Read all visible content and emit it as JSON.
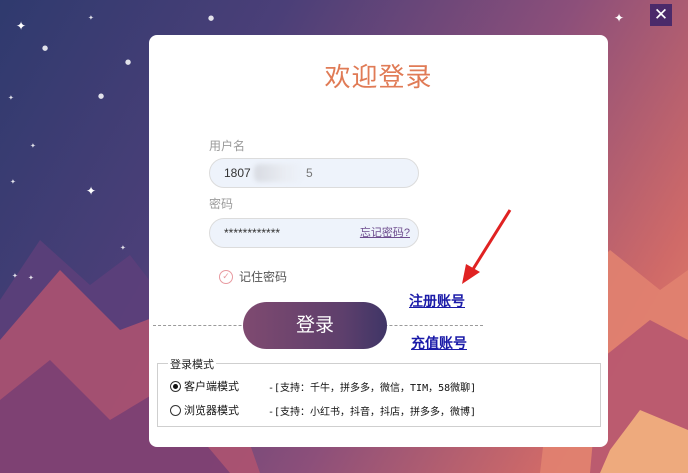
{
  "window": {
    "close_glyph": "✕"
  },
  "dialog": {
    "title": "欢迎登录",
    "username": {
      "label": "用户名",
      "value": "1807",
      "suffix": "5"
    },
    "password": {
      "label": "密码",
      "value": "************",
      "forgot_link": "忘记密码?"
    },
    "remember": {
      "label": "记住密码",
      "checked": true
    },
    "login_button": "登录",
    "register_link": "注册账号",
    "recharge_link": "充值账号",
    "login_mode": {
      "title": "登录模式",
      "options": [
        {
          "label": "客户端模式",
          "desc": "-[支持：千牛，拼多多，微信，TIM，58微聊]",
          "selected": true
        },
        {
          "label": "浏览器模式",
          "desc": "-[支持：小红书，抖音，抖店，拼多多，微博]",
          "selected": false
        }
      ]
    }
  },
  "colors": {
    "title": "#e07b56",
    "link": "#1a1aa8",
    "arrow": "#e02222"
  },
  "icons": {
    "close": "close-icon",
    "check": "check-icon",
    "arrow": "arrow-icon",
    "star": "star-icon"
  }
}
